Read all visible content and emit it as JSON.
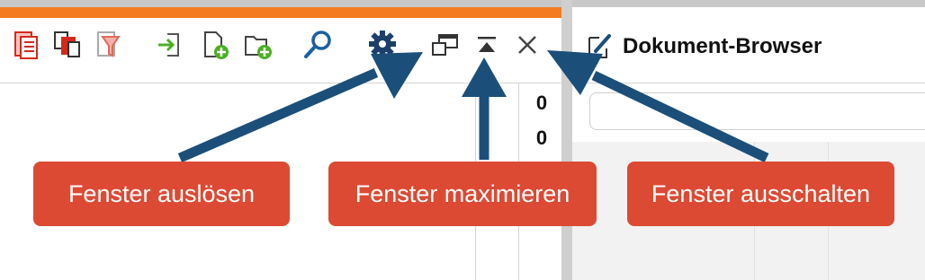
{
  "left_panel": {
    "toolbar_icons": [
      "document-list-icon",
      "copy-documents-icon",
      "filter-documents-icon",
      "import-icon",
      "new-document-icon",
      "new-folder-icon",
      "search-icon",
      "settings-gear-icon",
      "undock-window-icon",
      "maximize-window-icon",
      "close-icon"
    ],
    "counts": [
      "0",
      "0"
    ]
  },
  "right_panel": {
    "title": "Dokument-Browser",
    "title_icon": "edit-document-icon"
  },
  "callouts": {
    "undock": "Fenster auslösen",
    "maximize": "Fenster maximieren",
    "close": "Fenster ausschalten"
  },
  "colors": {
    "accent_orange": "#f47b20",
    "callout_red": "#dc4a34",
    "arrow_blue": "#1b4f7a",
    "icon_blue": "#1b5fa0",
    "icon_red": "#d42a1e",
    "icon_green": "#4caf26"
  }
}
